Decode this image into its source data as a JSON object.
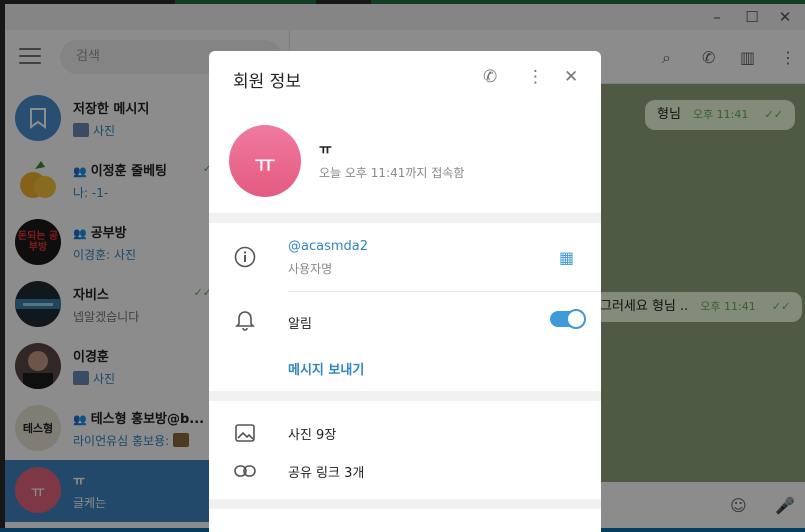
{
  "sidebar": {
    "search_placeholder": "검색",
    "chats": [
      {
        "title": "저장한 메시지",
        "sub": "사진",
        "group": false,
        "avatar_text": "",
        "avatar_color": "#4a8fd0"
      },
      {
        "title": "이정훈 줄베팅",
        "sub": "나: -1-",
        "group": true,
        "avatar_text": "",
        "avatar_color": "#f2b32a"
      },
      {
        "title": "공부방",
        "sub": "이경훈: 사진",
        "group": true,
        "avatar_text": "돈되는 공부방",
        "avatar_color": "#1b1b1b"
      },
      {
        "title": "자비스",
        "sub": "넵알겠습니다",
        "group": false,
        "avatar_text": "",
        "avatar_color": "#1e2a36"
      },
      {
        "title": "이경훈",
        "sub": "사진",
        "group": false,
        "avatar_text": "",
        "avatar_color": "#5a4a46"
      },
      {
        "title": "테스형 홍보방@b...",
        "sub": "라이언유심 홍보용:",
        "group": true,
        "avatar_text": "테스형",
        "avatar_color": "#e9e4d6"
      },
      {
        "title": "ㅠ",
        "sub": "글케는",
        "group": false,
        "avatar_text": "ㅠ",
        "avatar_color": "#e4647f"
      }
    ]
  },
  "chat": {
    "title": "ㅠ",
    "messages": [
      {
        "text": "형님",
        "time": "오후 11:41"
      },
      {
        "text": "그러세요 형님 ..",
        "time": "오후 11:41"
      }
    ]
  },
  "modal": {
    "title": "회원 정보",
    "avatar_text": "ㅠ",
    "name": "ㅠ",
    "status": "오늘 오후 11:41까지 접속함",
    "username": "@acasmda2",
    "username_label": "사용자명",
    "notifications_label": "알림",
    "notifications_on": true,
    "send_message": "메시지 보내기",
    "photos": "사진 9장",
    "shared_links": "공유 링크 3개"
  }
}
